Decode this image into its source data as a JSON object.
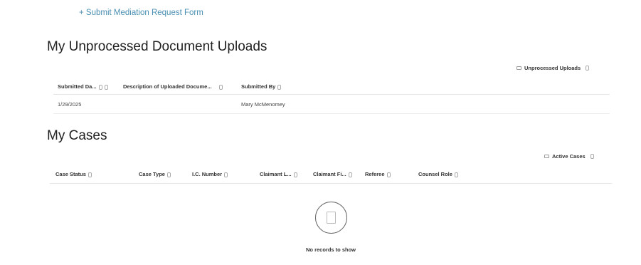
{
  "submit_link": "+ Submit Mediation Request Form",
  "uploads": {
    "title": "My Unprocessed Document Uploads",
    "view_label": "Unprocessed Uploads",
    "columns": [
      "Submitted Da...",
      "Description of Uploaded Docume...",
      "Submitted By"
    ],
    "rows": [
      {
        "submitted_date": "1/29/2025",
        "description": "",
        "submitted_by": "Mary McMenomey"
      }
    ]
  },
  "cases": {
    "title": "My Cases",
    "view_label": "Active Cases",
    "columns": [
      "Case Status",
      "Case Type",
      "I.C. Number",
      "Claimant L...",
      "Claimant Fi...",
      "Referee",
      "Counsel Role"
    ],
    "empty_text": "No records to show"
  }
}
